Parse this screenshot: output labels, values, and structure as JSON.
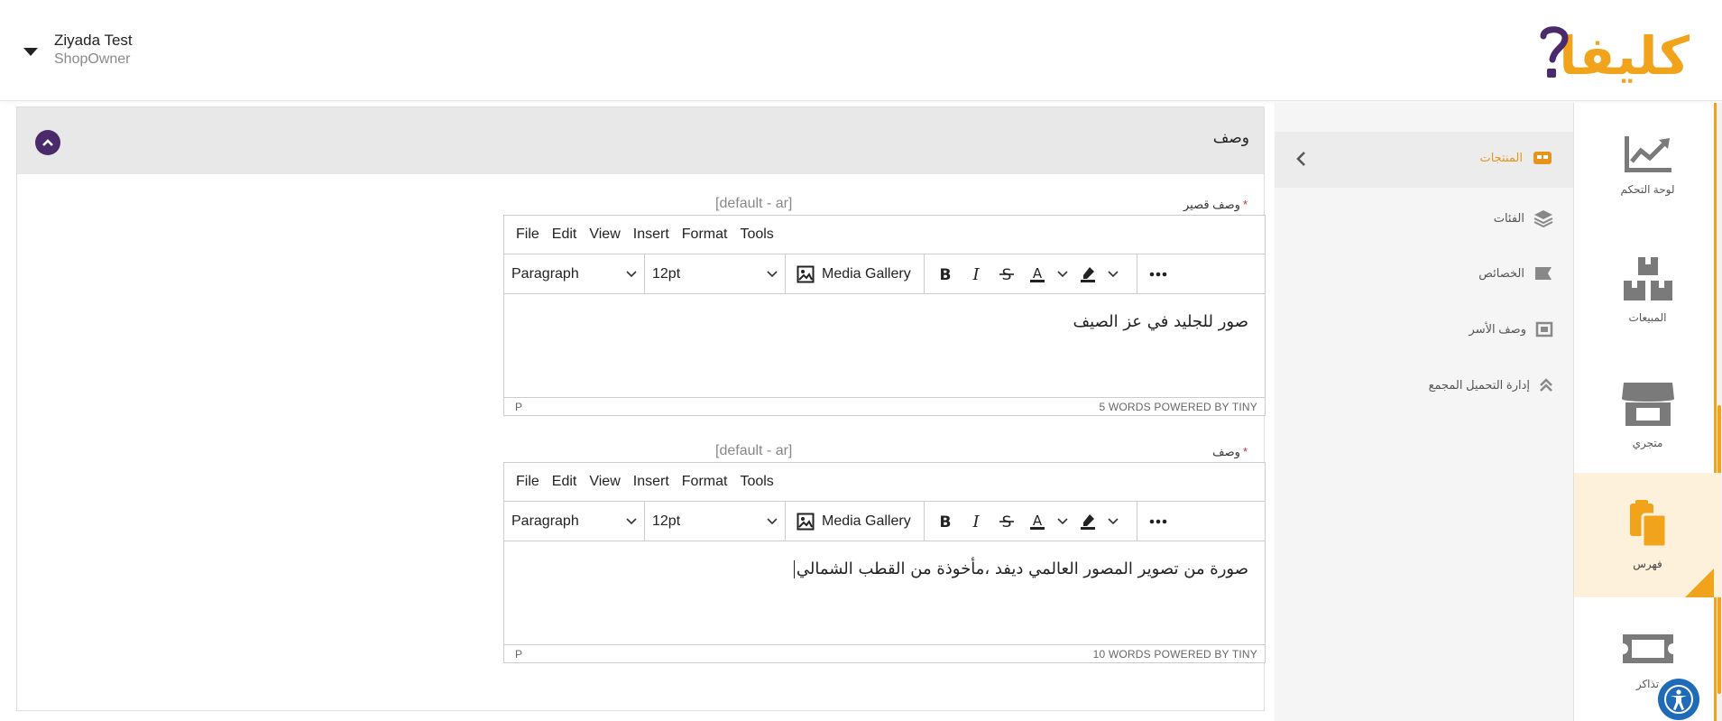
{
  "header": {
    "user_name": "Ziyada Test",
    "user_role": "ShopOwner",
    "logo_text": "كليفا"
  },
  "rail": {
    "items": [
      {
        "label": "لوحة التحكم",
        "icon": "chart-icon"
      },
      {
        "label": "المبيعات",
        "icon": "boxes-icon"
      },
      {
        "label": "متجري",
        "icon": "store-icon"
      },
      {
        "label": "فهرس",
        "icon": "clipboard-icon",
        "active": true
      },
      {
        "label": "تذاكر",
        "icon": "ticket-icon"
      }
    ]
  },
  "submenu": {
    "items": [
      {
        "label": "المنتجات",
        "icon": "products-icon",
        "active": true
      },
      {
        "label": "الفئات",
        "icon": "layers-icon"
      },
      {
        "label": "الخصائص",
        "icon": "properties-icon"
      },
      {
        "label": "وصف الأسر",
        "icon": "frame-icon"
      },
      {
        "label": "إدارة التحميل المجمع",
        "icon": "double-chevron-up-icon"
      }
    ]
  },
  "panel": {
    "title": "وصف",
    "fields": [
      {
        "label": "وصف قصير",
        "required": "*",
        "lang": "[default - ar]",
        "menu": [
          "File",
          "Edit",
          "View",
          "Insert",
          "Format",
          "Tools"
        ],
        "block_format": "Paragraph",
        "font_size": "12pt",
        "media_label": "Media Gallery",
        "text": "صور للجليد في عز الصيف",
        "path": "P",
        "status": "5 WORDS  POWERED BY TINY"
      },
      {
        "label": "وصف",
        "required": "*",
        "lang": "[default - ar]",
        "menu": [
          "File",
          "Edit",
          "View",
          "Insert",
          "Format",
          "Tools"
        ],
        "block_format": "Paragraph",
        "font_size": "12pt",
        "media_label": "Media Gallery",
        "text": "صورة من تصوير المصور العالمي ديفد ،مأخوذة من القطب الشمالي",
        "path": "P",
        "status": "10 WORDS  POWERED BY TINY"
      }
    ]
  },
  "colors": {
    "accent": "#f0a31b",
    "brand_purple": "#4a2a6a",
    "a11y_blue": "#1f6bb8"
  }
}
